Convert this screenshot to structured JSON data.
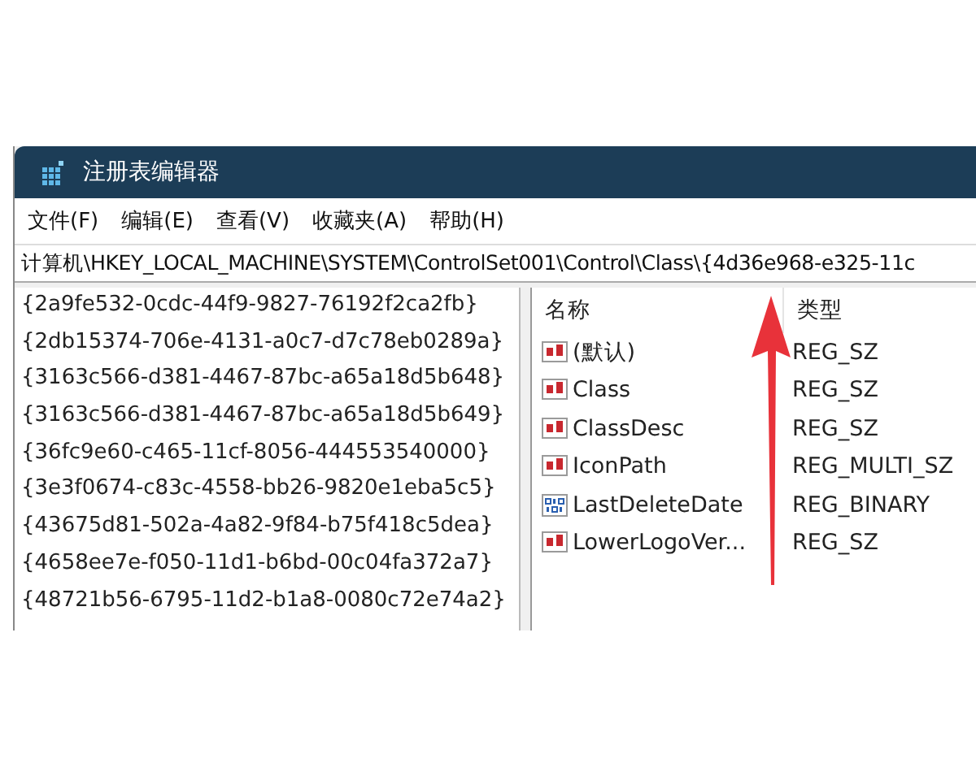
{
  "window": {
    "title": "注册表编辑器"
  },
  "menu": [
    "文件(F)",
    "编辑(E)",
    "查看(V)",
    "收藏夹(A)",
    "帮助(H)"
  ],
  "address": "计算机\\HKEY_LOCAL_MACHINE\\SYSTEM\\ControlSet001\\Control\\Class\\{4d36e968-e325-11c",
  "tree": [
    "{2a9fe532-0cdc-44f9-9827-76192f2ca2fb}",
    "{2db15374-706e-4131-a0c7-d7c78eb0289a}",
    "{3163c566-d381-4467-87bc-a65a18d5b648}",
    "{3163c566-d381-4467-87bc-a65a18d5b649}",
    "{36fc9e60-c465-11cf-8056-444553540000}",
    "{3e3f0674-c83c-4558-bb26-9820e1eba5c5}",
    "{43675d81-502a-4a82-9f84-b75f418c5dea}",
    "{4658ee7e-f050-11d1-b6bd-00c04fa372a7}",
    "{48721b56-6795-11d2-b1a8-0080c72e74a2}"
  ],
  "values": {
    "columns": [
      "名称",
      "类型"
    ],
    "rows": [
      {
        "kind": "string",
        "name": "(默认)",
        "type": "REG_SZ"
      },
      {
        "kind": "string",
        "name": "Class",
        "type": "REG_SZ"
      },
      {
        "kind": "string",
        "name": "ClassDesc",
        "type": "REG_SZ"
      },
      {
        "kind": "string",
        "name": "IconPath",
        "type": "REG_MULTI_SZ"
      },
      {
        "kind": "binary",
        "name": "LastDeleteDate",
        "type": "REG_BINARY"
      },
      {
        "kind": "string",
        "name": "LowerLogoVer...",
        "type": "REG_SZ"
      }
    ]
  }
}
